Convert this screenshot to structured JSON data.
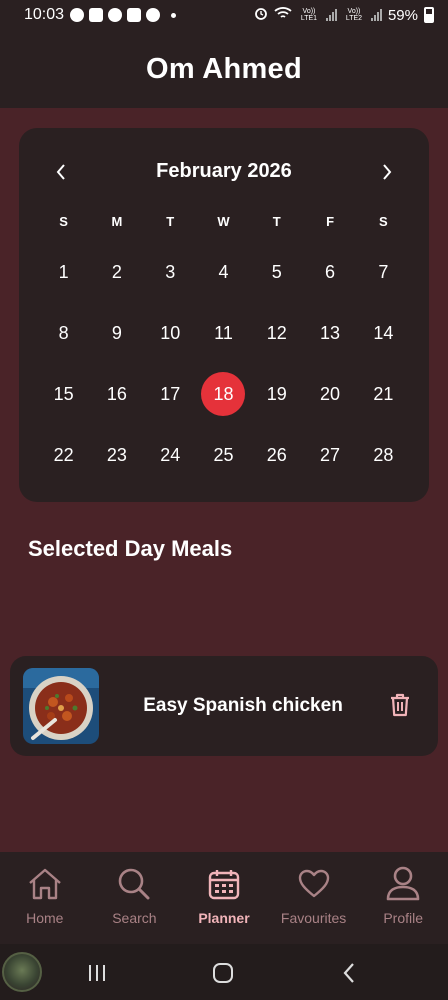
{
  "status_bar": {
    "time": "10:03",
    "network_1": "Vo)) LTE1",
    "network_2": "Vo)) LTE2",
    "battery": "59%"
  },
  "header": {
    "title": "Om Ahmed"
  },
  "calendar": {
    "month_label": "February 2026",
    "weekdays": [
      "S",
      "M",
      "T",
      "W",
      "T",
      "F",
      "S"
    ],
    "weeks": [
      [
        "1",
        "2",
        "3",
        "4",
        "5",
        "6",
        "7"
      ],
      [
        "8",
        "9",
        "10",
        "11",
        "12",
        "13",
        "14"
      ],
      [
        "15",
        "16",
        "17",
        "18",
        "19",
        "20",
        "21"
      ],
      [
        "22",
        "23",
        "24",
        "25",
        "26",
        "27",
        "28"
      ]
    ],
    "selected_day": "18",
    "selected_color": "#e5323a"
  },
  "meals_section": {
    "title": "Selected Day Meals",
    "meals": [
      {
        "name": "Easy Spanish chicken",
        "thumbnail_icon": "paella-dish-image",
        "action_icon": "trash-icon"
      }
    ]
  },
  "bottom_nav": {
    "items": [
      {
        "label": "Home",
        "icon": "home-icon",
        "active": false
      },
      {
        "label": "Search",
        "icon": "search-icon",
        "active": false
      },
      {
        "label": "Planner",
        "icon": "calendar-icon",
        "active": true
      },
      {
        "label": "Favourites",
        "icon": "heart-icon",
        "active": false
      },
      {
        "label": "Profile",
        "icon": "person-icon",
        "active": false
      }
    ]
  },
  "colors": {
    "background": "#4a2328",
    "surface": "#2a2021",
    "nav_active": "#f1b4b9",
    "nav_inactive": "#a98286"
  }
}
